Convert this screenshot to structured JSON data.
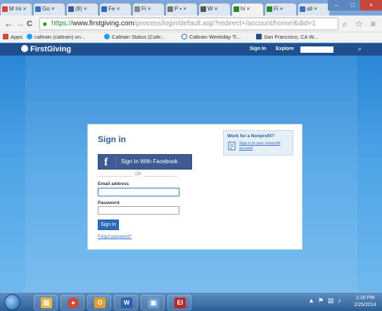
{
  "browser": {
    "tabs": [
      {
        "label": "M Ini",
        "favicon_color": "#d44638"
      },
      {
        "label": "Go",
        "favicon_color": "#3b6fc2"
      },
      {
        "label": "(8)",
        "favicon_color": "#3b5998"
      },
      {
        "label": "Fe",
        "favicon_color": "#2a6bbb"
      },
      {
        "label": "Fi",
        "favicon_color": "#888888"
      },
      {
        "label": "P •",
        "favicon_color": "#777777"
      },
      {
        "label": "W",
        "favicon_color": "#555555"
      },
      {
        "label": "hi",
        "favicon_color": "#2a8a2a"
      },
      {
        "label": "Fi",
        "favicon_color": "#2a8a2a"
      },
      {
        "label": "all",
        "favicon_color": "#3b6fc2"
      }
    ],
    "active_tab": 7,
    "window_controls": {
      "minimize": "–",
      "maximize": "□",
      "close": "×"
    },
    "nav": {
      "back": "←",
      "forward": "→",
      "reload": "C"
    },
    "url": {
      "scheme": "https://",
      "host": "www.firstgiving.com",
      "path": "/process/login/default.asp?redirect=/account/home/&did=1"
    },
    "omnibox_icons": {
      "search": "⌕",
      "star": "☆",
      "menu": "≡"
    },
    "bookmarks": [
      {
        "label": "Apps",
        "icon": "apps-grid-icon",
        "color": "#d44638"
      },
      {
        "label": "caltrain (caltrain) on...",
        "icon": "twitter-bird-icon",
        "color": "#1da1f2"
      },
      {
        "label": "Caltrain Status (Caltr...",
        "icon": "twitter-bird-icon",
        "color": "#1da1f2"
      },
      {
        "label": "Caltrain Weekday Ti...",
        "icon": "globe-icon",
        "color": "#2a6bbb"
      },
      {
        "label": "San Francisco, CA W...",
        "icon": "weather-icon",
        "color": "#1f4f8e"
      }
    ]
  },
  "site": {
    "brand": "FirstGiving",
    "nav": {
      "signin": "Sign In",
      "explore": "Explore"
    },
    "search_icon": "⌕"
  },
  "login": {
    "title": "Sign in",
    "facebook_button": "Sign In With Facebook",
    "facebook_glyph": "f",
    "or_text": "OR",
    "email_label": "Email address",
    "email_value": "",
    "password_label": "Password",
    "password_value": "",
    "submit": "Sign In",
    "forgot": "Forgot password?"
  },
  "nonprofit": {
    "title": "Work for a Nonprofit?",
    "link": "Sign in to your nonprofit account"
  },
  "taskbar": {
    "apps": [
      {
        "name": "explorer",
        "glyph": "▤",
        "color": "#e8b84a"
      },
      {
        "name": "chrome",
        "glyph": "●",
        "color": "#d44638"
      },
      {
        "name": "outlook",
        "glyph": "O",
        "color": "#e0a030"
      },
      {
        "name": "word",
        "glyph": "W",
        "color": "#2b5fb4"
      },
      {
        "name": "folder",
        "glyph": "▣",
        "color": "#6aa0d8"
      },
      {
        "name": "evernote",
        "glyph": "EI",
        "color": "#b8282a"
      }
    ],
    "clock_time": "1:16 PM",
    "clock_date": "2/25/2014"
  }
}
